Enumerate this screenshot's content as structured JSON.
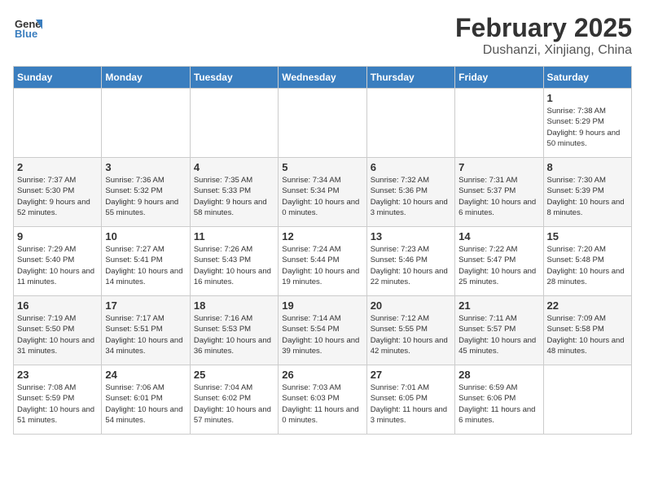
{
  "header": {
    "logo_general": "General",
    "logo_blue": "Blue",
    "month_title": "February 2025",
    "location": "Dushanzi, Xinjiang, China"
  },
  "weekdays": [
    "Sunday",
    "Monday",
    "Tuesday",
    "Wednesday",
    "Thursday",
    "Friday",
    "Saturday"
  ],
  "weeks": [
    [
      {
        "day": "",
        "info": ""
      },
      {
        "day": "",
        "info": ""
      },
      {
        "day": "",
        "info": ""
      },
      {
        "day": "",
        "info": ""
      },
      {
        "day": "",
        "info": ""
      },
      {
        "day": "",
        "info": ""
      },
      {
        "day": "1",
        "info": "Sunrise: 7:38 AM\nSunset: 5:29 PM\nDaylight: 9 hours and 50 minutes."
      }
    ],
    [
      {
        "day": "2",
        "info": "Sunrise: 7:37 AM\nSunset: 5:30 PM\nDaylight: 9 hours and 52 minutes."
      },
      {
        "day": "3",
        "info": "Sunrise: 7:36 AM\nSunset: 5:32 PM\nDaylight: 9 hours and 55 minutes."
      },
      {
        "day": "4",
        "info": "Sunrise: 7:35 AM\nSunset: 5:33 PM\nDaylight: 9 hours and 58 minutes."
      },
      {
        "day": "5",
        "info": "Sunrise: 7:34 AM\nSunset: 5:34 PM\nDaylight: 10 hours and 0 minutes."
      },
      {
        "day": "6",
        "info": "Sunrise: 7:32 AM\nSunset: 5:36 PM\nDaylight: 10 hours and 3 minutes."
      },
      {
        "day": "7",
        "info": "Sunrise: 7:31 AM\nSunset: 5:37 PM\nDaylight: 10 hours and 6 minutes."
      },
      {
        "day": "8",
        "info": "Sunrise: 7:30 AM\nSunset: 5:39 PM\nDaylight: 10 hours and 8 minutes."
      }
    ],
    [
      {
        "day": "9",
        "info": "Sunrise: 7:29 AM\nSunset: 5:40 PM\nDaylight: 10 hours and 11 minutes."
      },
      {
        "day": "10",
        "info": "Sunrise: 7:27 AM\nSunset: 5:41 PM\nDaylight: 10 hours and 14 minutes."
      },
      {
        "day": "11",
        "info": "Sunrise: 7:26 AM\nSunset: 5:43 PM\nDaylight: 10 hours and 16 minutes."
      },
      {
        "day": "12",
        "info": "Sunrise: 7:24 AM\nSunset: 5:44 PM\nDaylight: 10 hours and 19 minutes."
      },
      {
        "day": "13",
        "info": "Sunrise: 7:23 AM\nSunset: 5:46 PM\nDaylight: 10 hours and 22 minutes."
      },
      {
        "day": "14",
        "info": "Sunrise: 7:22 AM\nSunset: 5:47 PM\nDaylight: 10 hours and 25 minutes."
      },
      {
        "day": "15",
        "info": "Sunrise: 7:20 AM\nSunset: 5:48 PM\nDaylight: 10 hours and 28 minutes."
      }
    ],
    [
      {
        "day": "16",
        "info": "Sunrise: 7:19 AM\nSunset: 5:50 PM\nDaylight: 10 hours and 31 minutes."
      },
      {
        "day": "17",
        "info": "Sunrise: 7:17 AM\nSunset: 5:51 PM\nDaylight: 10 hours and 34 minutes."
      },
      {
        "day": "18",
        "info": "Sunrise: 7:16 AM\nSunset: 5:53 PM\nDaylight: 10 hours and 36 minutes."
      },
      {
        "day": "19",
        "info": "Sunrise: 7:14 AM\nSunset: 5:54 PM\nDaylight: 10 hours and 39 minutes."
      },
      {
        "day": "20",
        "info": "Sunrise: 7:12 AM\nSunset: 5:55 PM\nDaylight: 10 hours and 42 minutes."
      },
      {
        "day": "21",
        "info": "Sunrise: 7:11 AM\nSunset: 5:57 PM\nDaylight: 10 hours and 45 minutes."
      },
      {
        "day": "22",
        "info": "Sunrise: 7:09 AM\nSunset: 5:58 PM\nDaylight: 10 hours and 48 minutes."
      }
    ],
    [
      {
        "day": "23",
        "info": "Sunrise: 7:08 AM\nSunset: 5:59 PM\nDaylight: 10 hours and 51 minutes."
      },
      {
        "day": "24",
        "info": "Sunrise: 7:06 AM\nSunset: 6:01 PM\nDaylight: 10 hours and 54 minutes."
      },
      {
        "day": "25",
        "info": "Sunrise: 7:04 AM\nSunset: 6:02 PM\nDaylight: 10 hours and 57 minutes."
      },
      {
        "day": "26",
        "info": "Sunrise: 7:03 AM\nSunset: 6:03 PM\nDaylight: 11 hours and 0 minutes."
      },
      {
        "day": "27",
        "info": "Sunrise: 7:01 AM\nSunset: 6:05 PM\nDaylight: 11 hours and 3 minutes."
      },
      {
        "day": "28",
        "info": "Sunrise: 6:59 AM\nSunset: 6:06 PM\nDaylight: 11 hours and 6 minutes."
      },
      {
        "day": "",
        "info": ""
      }
    ]
  ]
}
